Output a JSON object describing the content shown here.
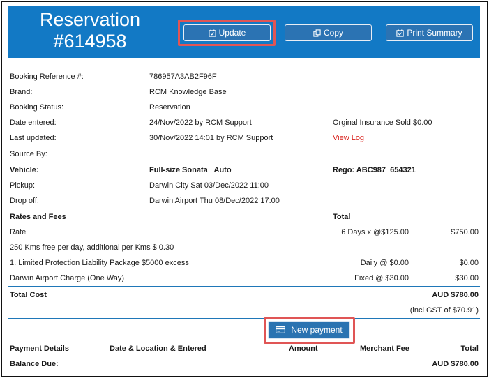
{
  "header": {
    "title_line1": "Reservation",
    "title_line2": "#614958",
    "buttons": {
      "update": "Update",
      "copy": "Copy",
      "print": "Print Summary"
    }
  },
  "details": {
    "booking_reference": {
      "label": "Booking Reference #:",
      "value": "786957A3AB2F96F"
    },
    "brand": {
      "label": "Brand:",
      "value": "RCM Knowledge Base"
    },
    "booking_status": {
      "label": "Booking Status:",
      "value": "Reservation"
    },
    "date_entered": {
      "label": "Date entered:",
      "value": "24/Nov/2022 by RCM Support",
      "extra": "Orginal Insurance Sold $0.00"
    },
    "last_updated": {
      "label": "Last updated:",
      "value": "30/Nov/2022 14:01 by RCM Support",
      "link": "View Log"
    },
    "source_by": {
      "label": "Source By:"
    }
  },
  "vehicle": {
    "label": "Vehicle:",
    "value": "Full-size Sonata   Auto",
    "rego": "Rego: ABC987  654321",
    "pickup_label": "Pickup:",
    "pickup_value": "Darwin City Sat 03/Dec/2022 11:00",
    "dropoff_label": "Drop off:",
    "dropoff_value": "Darwin Airport Thu 08/Dec/2022 17:00"
  },
  "rates": {
    "heading": "Rates and Fees",
    "total_heading": "Total",
    "items": [
      {
        "name": "Rate",
        "calc": "6 Days x @$125.00",
        "amount": "$750.00"
      },
      {
        "name": "250 Kms free per day, additional per Kms $ 0.30",
        "calc": "",
        "amount": ""
      },
      {
        "name": "1. Limited Protection Liability Package $5000 excess",
        "calc": "Daily @ $0.00",
        "amount": "$0.00"
      },
      {
        "name": "Darwin Airport Charge (One Way)",
        "calc": "Fixed @ $30.00",
        "amount": "$30.00"
      }
    ],
    "total_cost_label": "Total Cost",
    "total_cost_value": "AUD $780.00",
    "gst_note": "(incl GST of $70.91)"
  },
  "payment": {
    "new_payment_label": "New payment",
    "columns": [
      "Payment Details",
      "Date & Location & Entered",
      "Amount",
      "Merchant Fee",
      "Total"
    ],
    "balance_label": "Balance Due:",
    "balance_value": "AUD $780.00"
  },
  "colors": {
    "header_bg": "#1279c5",
    "button_bg": "#2b73b3",
    "highlight": "#e05555",
    "link_red": "#d9221c",
    "divider": "#1f77b8"
  }
}
